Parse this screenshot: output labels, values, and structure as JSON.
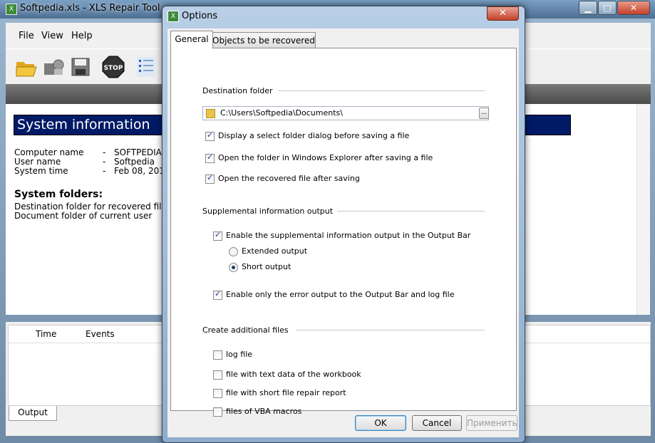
{
  "main": {
    "title": "Softpedia.xls - XLS Repair Tool",
    "window_buttons": {
      "minimize": "▁",
      "maximize": "□",
      "close": "✕"
    },
    "menu": [
      "File",
      "View",
      "Help"
    ],
    "system_info_title": "System information",
    "info": [
      {
        "key": "Computer name",
        "sep": "-",
        "value": "SOFTPEDIA"
      },
      {
        "key": "User name",
        "sep": "-",
        "value": "Softpedia"
      },
      {
        "key": "System time",
        "sep": "-",
        "value": "Feb 08, 201"
      }
    ],
    "system_folders_title": "System folders:",
    "folders": [
      "Destination folder for recovered file",
      "Document folder of current user"
    ],
    "output_columns": [
      "Time",
      "Events"
    ],
    "output_tab": "Output"
  },
  "dialog": {
    "title": "Options",
    "close": "✕",
    "tabs": [
      "General",
      "Objects to be recovered"
    ],
    "destination_group": "Destination folder",
    "destination_path": "C:\\Users\\Softpedia\\Documents\\",
    "browse_label": "...",
    "dest_options": [
      {
        "label": "Display a select folder dialog before saving a file",
        "checked": true
      },
      {
        "label": "Open the folder in Windows Explorer after saving a file",
        "checked": true
      },
      {
        "label": "Open the recovered file after saving",
        "checked": true
      }
    ],
    "supplemental_group": "Supplemental information output",
    "supplemental_enable": {
      "label": "Enable the supplemental information output in the Output Bar",
      "checked": true
    },
    "output_modes": [
      {
        "label": "Extended output",
        "selected": false
      },
      {
        "label": "Short output",
        "selected": true
      }
    ],
    "error_only": {
      "label": "Enable only the error output to the Output Bar and log file",
      "checked": true
    },
    "additional_group": "Create additional files",
    "additional_files": [
      {
        "label": "log file",
        "checked": false
      },
      {
        "label": "file with text data of the workbook",
        "checked": false
      },
      {
        "label": "file with short file repair report",
        "checked": false
      },
      {
        "label": "files of VBA macros",
        "checked": false
      }
    ],
    "buttons": {
      "ok": "OK",
      "cancel": "Cancel",
      "apply": "Применить"
    }
  }
}
